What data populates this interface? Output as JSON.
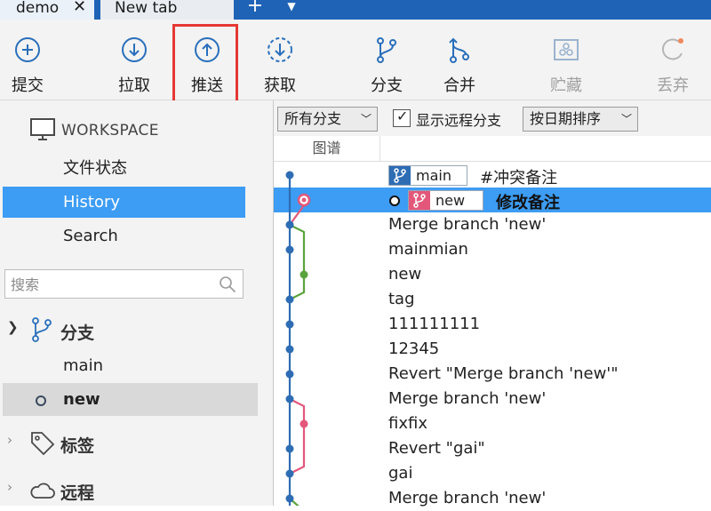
{
  "tabs": [
    {
      "label": "demo",
      "close": "✕"
    },
    {
      "label": "New tab"
    }
  ],
  "tab_add": "+",
  "tab_menu": "▼",
  "toolbar": {
    "commit": "提交",
    "pull": "拉取",
    "push": "推送",
    "fetch": "获取",
    "branch": "分支",
    "merge": "合并",
    "stash": "贮藏",
    "discard": "丢弃"
  },
  "sidebar": {
    "workspace": "WORKSPACE",
    "items": [
      "文件状态",
      "History",
      "Search"
    ],
    "search_placeholder": "搜索",
    "branches_header": "分支",
    "branches": [
      "main",
      "new"
    ],
    "tags_header": "标签",
    "remote_header": "远程"
  },
  "filterbar": {
    "branches_select": "所有分支",
    "show_remote": "显示远程分支",
    "sort_select": "按日期排序"
  },
  "columns": {
    "graph": "图谱"
  },
  "commits": [
    {
      "message": "#冲突备注",
      "badge": "main"
    },
    {
      "message": "修改备注",
      "badge": "new"
    },
    {
      "message": "Merge branch 'new'"
    },
    {
      "message": "mainmian"
    },
    {
      "message": "new"
    },
    {
      "message": "tag"
    },
    {
      "message": "111111111"
    },
    {
      "message": "12345"
    },
    {
      "message": "Revert \"Merge branch 'new'\""
    },
    {
      "message": "Merge branch 'new'"
    },
    {
      "message": "fixfix"
    },
    {
      "message": "Revert \"gai\""
    },
    {
      "message": "gai"
    },
    {
      "message": "Merge branch 'new'"
    }
  ],
  "colors": {
    "accent": "#1f63b6",
    "selection": "#3d9cf3",
    "lane_main": "#2e6db4",
    "lane_green": "#5aa33c",
    "lane_pink": "#e3577a",
    "highlight_box": "#e53935"
  }
}
